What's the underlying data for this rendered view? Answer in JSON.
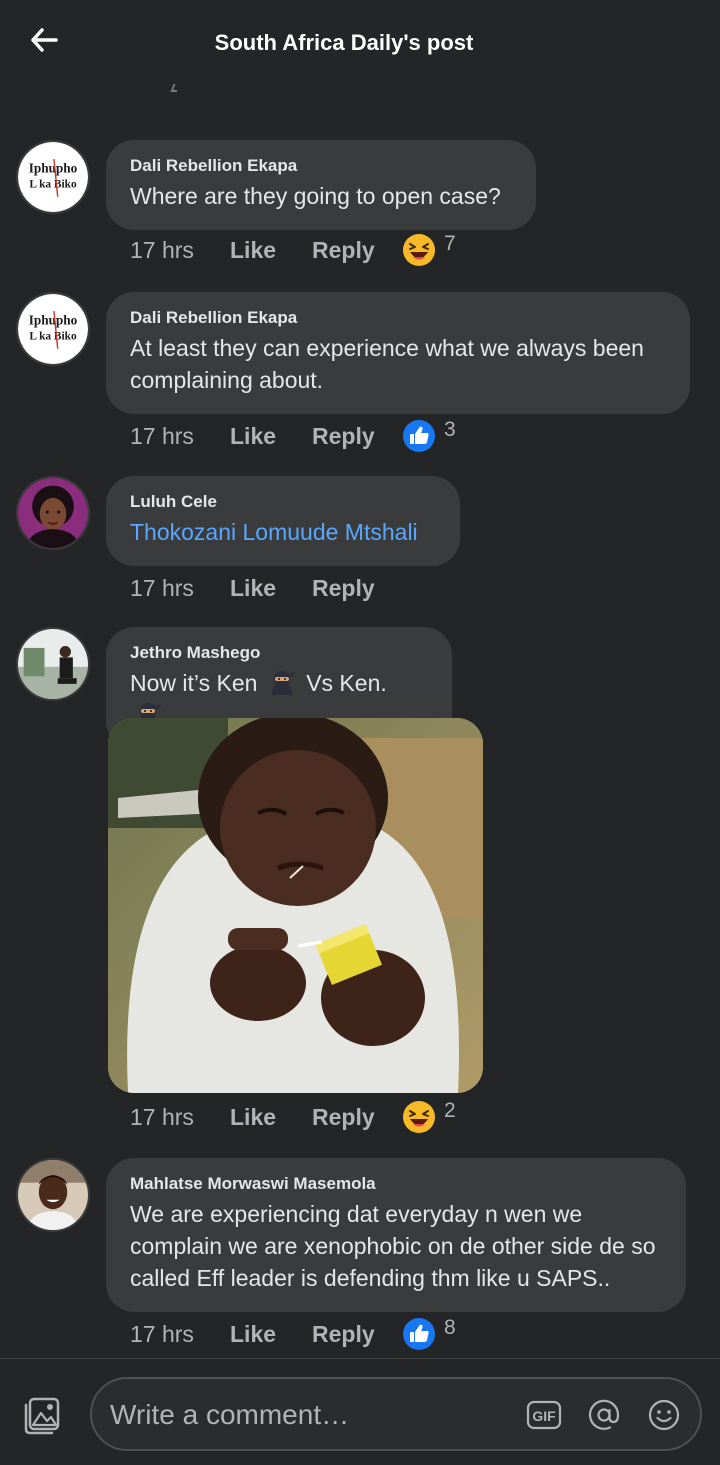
{
  "header": {
    "title": "South Africa Daily's post"
  },
  "comments": [
    {
      "author": "Dali Rebellion Ekapa",
      "text": "Where are they going to open case?",
      "time": "17 hrs",
      "like": "Like",
      "reply": "Reply",
      "reaction": "haha-icon",
      "count": "7"
    },
    {
      "author": "Dali Rebellion Ekapa",
      "text": "At least they can experience what we always been complaining about.",
      "time": "17 hrs",
      "like": "Like",
      "reply": "Reply",
      "reaction": "like-icon",
      "count": "3"
    },
    {
      "author": "Luluh Cele",
      "text": "Thokozani Lomuude Mtshali",
      "time": "17 hrs",
      "like": "Like",
      "reply": "Reply"
    },
    {
      "author": "Jethro Mashego",
      "text_a": "Now it’s Ken",
      "text_b": "Vs Ken.",
      "time": "17 hrs",
      "like": "Like",
      "reply": "Reply",
      "reaction": "haha-icon",
      "count": "2"
    },
    {
      "author": "Mahlatse Morwaswi Masemola",
      "text": "We are experiencing dat everyday n wen we complain we are xenophobic on de other side de so called Eff leader is defending thm like u SAPS..",
      "time": "17 hrs",
      "like": "Like",
      "reply": "Reply",
      "reaction": "like-icon",
      "count": "8"
    }
  ],
  "avatar_logo": {
    "line1": "Iphupho",
    "line2": "L ka Biko"
  },
  "composer": {
    "placeholder": "Write a comment…",
    "gif": "GIF"
  },
  "colors": {
    "background": "#242527",
    "bubble": "#3a3b3c",
    "text": "#e4e6eb",
    "secondary": "#b0b3b8",
    "mention": "#5aa7ff",
    "like_blue": "#1877f2",
    "haha_yellow": "#f7b928"
  }
}
